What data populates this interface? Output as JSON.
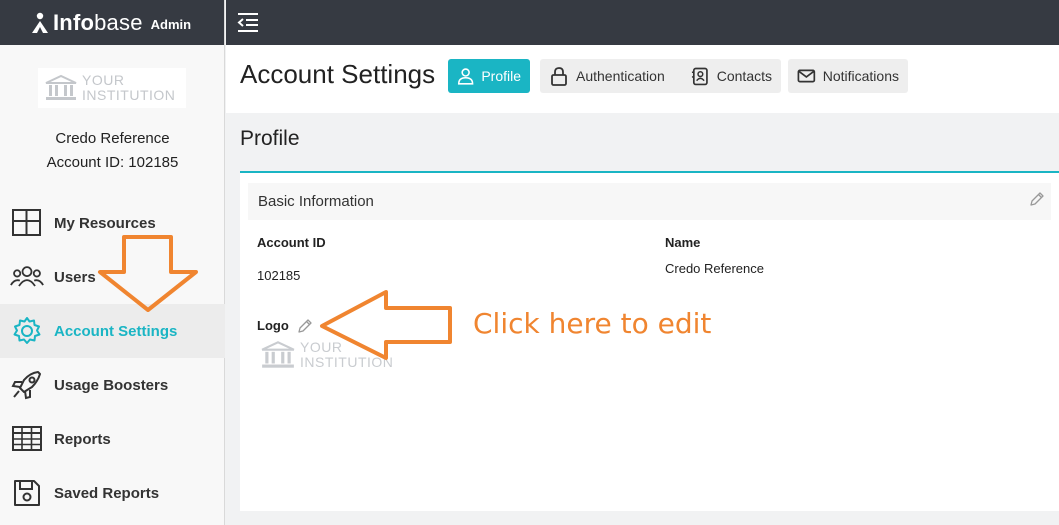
{
  "brand": {
    "name_bold": "Info",
    "name_rest": "base",
    "admin_label": "Admin"
  },
  "sidebar": {
    "institution_logo": {
      "line1": "YOUR",
      "line2": "INSTITUTION"
    },
    "account_name": "Credo Reference",
    "account_id_text": "Account ID: 102185",
    "items": [
      {
        "label": "My Resources",
        "icon": "grid-icon"
      },
      {
        "label": "Users",
        "icon": "users-icon"
      },
      {
        "label": "Account Settings",
        "icon": "gear-icon",
        "active": true
      },
      {
        "label": "Usage Boosters",
        "icon": "rocket-icon"
      },
      {
        "label": "Reports",
        "icon": "table-icon"
      },
      {
        "label": "Saved Reports",
        "icon": "floppy-icon"
      }
    ]
  },
  "header": {
    "title": "Account Settings",
    "tabs": [
      {
        "label": "Profile",
        "icon": "user-icon",
        "active": true
      },
      {
        "label": "Authentication",
        "icon": "lock-icon"
      },
      {
        "label": "Contacts",
        "icon": "contact-card-icon"
      },
      {
        "label": "Notifications",
        "icon": "envelope-icon"
      }
    ]
  },
  "profile": {
    "section_title": "Profile",
    "card_title": "Basic Information",
    "account_id_label": "Account ID",
    "account_id_value": "102185",
    "name_label": "Name",
    "name_value": "Credo Reference",
    "logo_label": "Logo",
    "logo": {
      "line1": "YOUR",
      "line2": "INSTITUTION"
    }
  },
  "annotation": {
    "text": "Click here to edit"
  },
  "colors": {
    "accent": "#1ab5c4",
    "topbar": "#363a42",
    "annotation": "#f08530"
  }
}
